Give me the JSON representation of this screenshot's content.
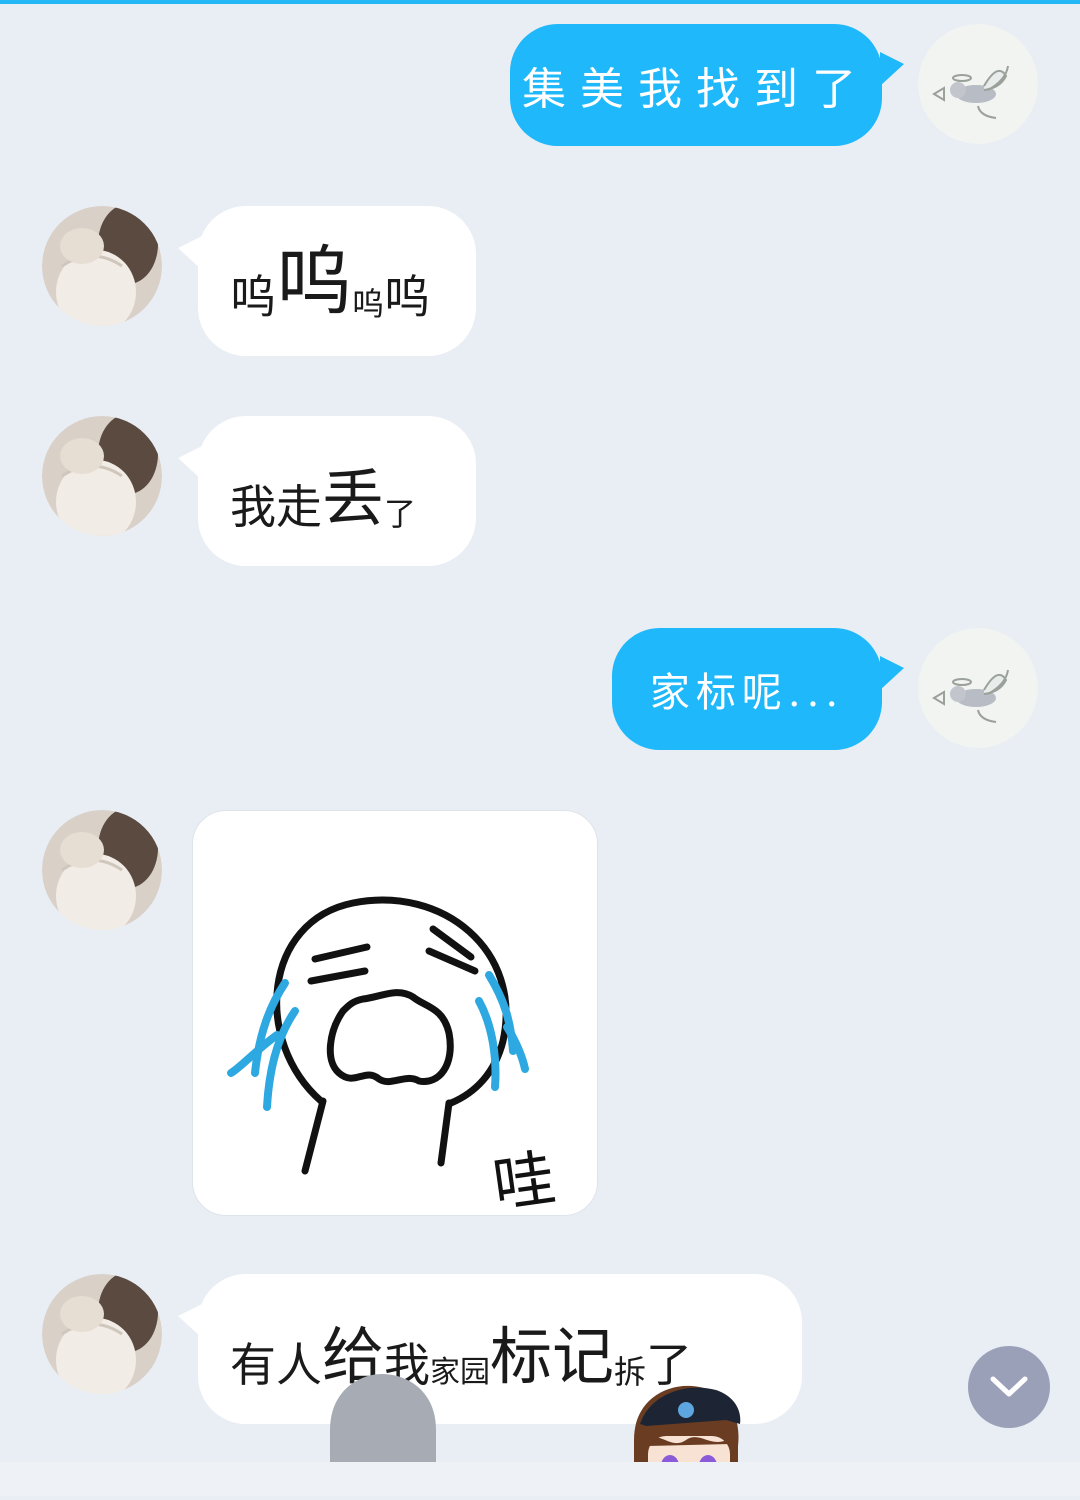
{
  "messages": [
    {
      "direction": "outgoing",
      "type": "text",
      "text": "集美我找到了",
      "avatar": "angel-doodle-avatar"
    },
    {
      "direction": "incoming",
      "type": "text",
      "segments": [
        "呜",
        "呜",
        "呜",
        "呜"
      ],
      "avatar": "lace-dress-avatar"
    },
    {
      "direction": "incoming",
      "type": "text",
      "segments": [
        "我走",
        "丢",
        "了"
      ],
      "avatar": "lace-dress-avatar"
    },
    {
      "direction": "outgoing",
      "type": "text",
      "text": "家标呢...",
      "avatar": "angel-doodle-avatar"
    },
    {
      "direction": "incoming",
      "type": "sticker",
      "sticker_text": "哇",
      "sticker": "crying-face-sticker",
      "avatar": "lace-dress-avatar"
    },
    {
      "direction": "incoming",
      "type": "text",
      "segments": [
        "有人",
        "给",
        "我",
        "家园",
        "标记",
        "拆",
        "了"
      ],
      "avatar": "lace-dress-avatar"
    }
  ],
  "scroll_button": {
    "icon": "chevron-down-icon"
  },
  "colors": {
    "accent": "#1eb8fb",
    "background": "#e9edf4",
    "incoming_bubble": "#ffffff",
    "scroll_button": "#9aa0b8"
  }
}
